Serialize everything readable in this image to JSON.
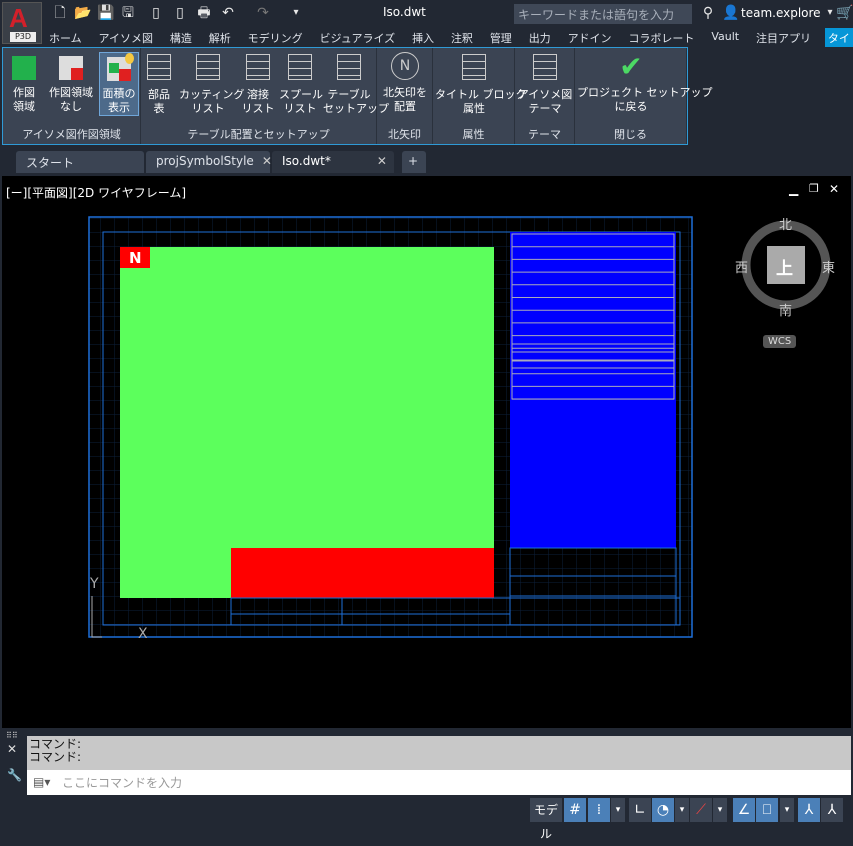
{
  "app": {
    "logo_text": "A",
    "logo_sub": "P3D",
    "title": "Iso.dwt",
    "search_placeholder": "キーワードまたは語句を入力",
    "user": "team.explore"
  },
  "ribbon_tabs": [
    "ホーム",
    "アイソメ図",
    "構造",
    "解析",
    "モデリング",
    "ビジュアライズ",
    "挿入",
    "注釈",
    "管理",
    "出力",
    "アドイン",
    "コラボレート",
    "Vault",
    "注目アプリ",
    "タイ"
  ],
  "active_tab": 14,
  "panels": [
    {
      "title": "アイソメ図作図領域",
      "buttons": [
        "作図\n領域",
        "作図領域\nなし",
        "面積の\n表示"
      ]
    },
    {
      "title": "テーブル配置とセットアップ",
      "buttons": [
        "部品\n表",
        "カッティング\nリスト",
        "溶接\nリスト",
        "スプール\nリスト",
        "テーブル\nセットアップ"
      ]
    },
    {
      "title": "北矢印",
      "buttons": [
        "北矢印を\n配置"
      ]
    },
    {
      "title": "属性",
      "buttons": [
        "タイトル ブロック\n属性"
      ]
    },
    {
      "title": "テーマ",
      "buttons": [
        "アイソメ図\nテーマ"
      ]
    },
    {
      "title": "閉じる",
      "buttons": [
        "プロジェクト セットアップ\nに戻る"
      ]
    }
  ],
  "doc_tabs": [
    {
      "label": "スタート"
    },
    {
      "label": "projSymbolStyle",
      "close": "✕"
    },
    {
      "label": "Iso.dwt*",
      "close": "✕",
      "active": true
    }
  ],
  "viewport": {
    "label": "[ー][平面図][2D ワイヤフレーム]",
    "north": "北",
    "south": "南",
    "east": "東",
    "west": "西",
    "top": "上",
    "wcs": "WCS",
    "colors": {
      "area": "#5cff5c",
      "red": "#ff0000",
      "table": "#0000ff",
      "frame": "#1e6fd9"
    }
  },
  "command": {
    "history": [
      "コマンド:",
      "コマンド:"
    ],
    "placeholder": "ここにコマンドを入力"
  },
  "status": {
    "model": "モデル"
  }
}
